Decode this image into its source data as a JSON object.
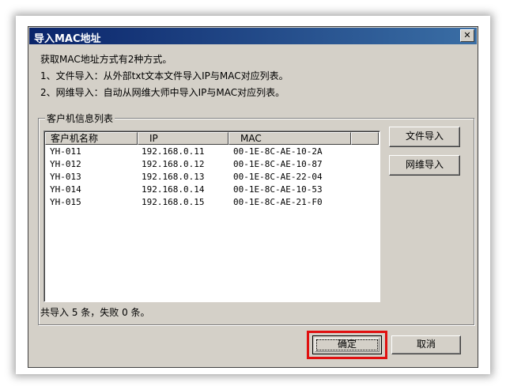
{
  "dialog": {
    "title": "导入MAC地址",
    "close_glyph": "✕"
  },
  "description": {
    "line1": "获取MAC地址方式有2种方式。",
    "line2": "1、文件导入：从外部txt文本文件导入IP与MAC对应列表。",
    "line3": "2、网维导入：自动从网维大师中导入IP与MAC对应列表。"
  },
  "group": {
    "legend": "客户机信息列表"
  },
  "list": {
    "columns": [
      "客户机名称",
      "IP",
      "MAC"
    ],
    "rows": [
      {
        "name": "YH-011",
        "ip": "192.168.0.11",
        "mac": "00-1E-8C-AE-10-2A"
      },
      {
        "name": "YH-012",
        "ip": "192.168.0.12",
        "mac": "00-1E-8C-AE-10-87"
      },
      {
        "name": "YH-013",
        "ip": "192.168.0.13",
        "mac": "00-1E-8C-AE-22-04"
      },
      {
        "name": "YH-014",
        "ip": "192.168.0.14",
        "mac": "00-1E-8C-AE-10-53"
      },
      {
        "name": "YH-015",
        "ip": "192.168.0.15",
        "mac": "00-1E-8C-AE-21-F0"
      }
    ]
  },
  "buttons": {
    "file_import": "文件导入",
    "netwei_import": "网维导入",
    "ok": "确定",
    "cancel": "取消"
  },
  "summary": "共导入 5 条，失败 0 条。",
  "colors": {
    "highlight": "#e01010",
    "titlebar": "#0a246a"
  }
}
